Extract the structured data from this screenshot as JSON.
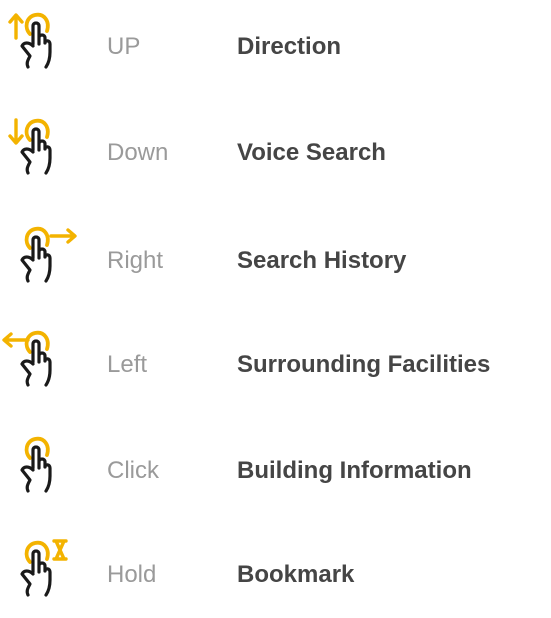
{
  "accent_color": "#f3b300",
  "hand_color": "#1a1a1a",
  "gestures": [
    {
      "gesture": "UP",
      "action": "Direction",
      "icon": "swipe-up-icon"
    },
    {
      "gesture": "Down",
      "action": "Voice Search",
      "icon": "swipe-down-icon"
    },
    {
      "gesture": "Right",
      "action": "Search History",
      "icon": "swipe-right-icon"
    },
    {
      "gesture": "Left",
      "action": "Surrounding Facilities",
      "icon": "swipe-left-icon"
    },
    {
      "gesture": "Click",
      "action": "Building Information",
      "icon": "tap-icon"
    },
    {
      "gesture": "Hold",
      "action": "Bookmark",
      "icon": "long-press-icon"
    }
  ]
}
